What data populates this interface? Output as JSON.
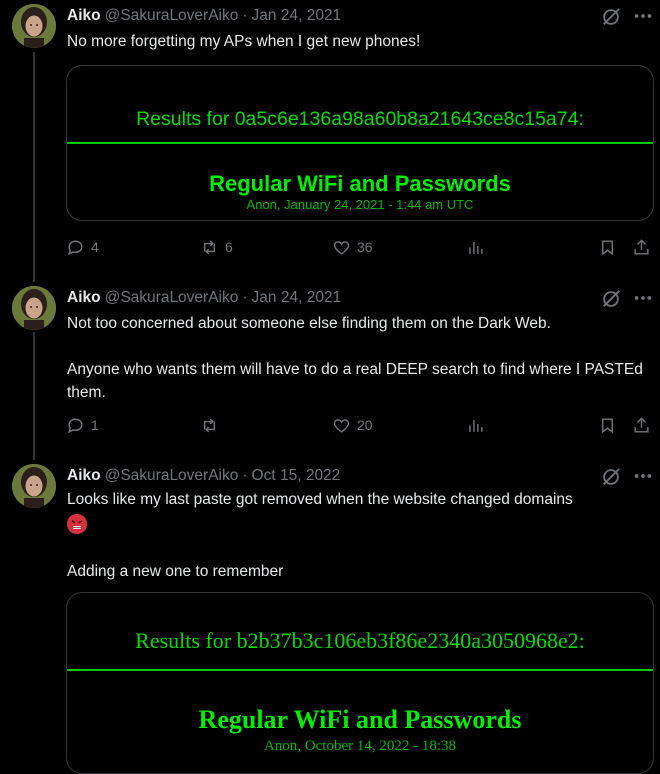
{
  "tweets": [
    {
      "name": "Aiko",
      "handle": "@SakuraLoverAiko",
      "date": "Jan 24, 2021",
      "text_lines": [
        "No more forgetting my APs when I get new phones!"
      ],
      "card": {
        "results": "Results for 0a5c6e136a98a60b8a21643ce8c15a74:",
        "title": "Regular WiFi and Passwords",
        "subtitle": "Anon, January 24, 2021 - 1:44 am UTC"
      },
      "replies": "4",
      "reposts": "6",
      "likes": "36"
    },
    {
      "name": "Aiko",
      "handle": "@SakuraLoverAiko",
      "date": "Jan 24, 2021",
      "text_lines": [
        "Not too concerned about someone else finding them on the Dark Web.",
        "",
        "Anyone who wants them will have to do a real DEEP search to find where I PASTEd them."
      ],
      "replies": "1",
      "reposts": "",
      "likes": "20"
    },
    {
      "name": "Aiko",
      "handle": "@SakuraLoverAiko",
      "date": "Oct 15, 2022",
      "text_lines": [
        "Looks like my last paste got removed when the website changed domains",
        "",
        "Adding a new one to remember"
      ],
      "emoji": "angry-face-emoji",
      "card": {
        "results": "Results for b2b37b3c106eb3f86e2340a3050968e2:",
        "title": "Regular WiFi and Passwords",
        "subtitle": "Anon, October 14, 2022 - 18:38"
      }
    }
  ],
  "colors": {
    "background": "#000000",
    "text": "#e7e9ea",
    "muted": "#71767b",
    "terminal_green": "#00ee00",
    "border": "#333639"
  }
}
